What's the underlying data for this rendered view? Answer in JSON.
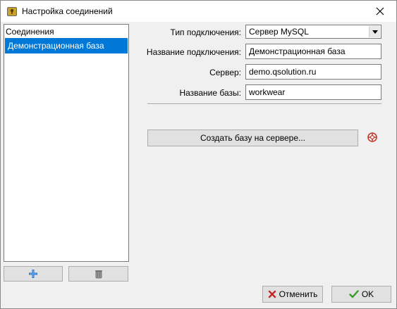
{
  "window": {
    "title": "Настройка соединений"
  },
  "connections": {
    "header": "Соединения",
    "items": [
      "Демонстрационная база"
    ],
    "selected_index": 0
  },
  "form": {
    "connection_type": {
      "label": "Тип подключения:",
      "value": "Сервер MySQL"
    },
    "connection_name": {
      "label": "Название подключения:",
      "value": "Демонстрационная база"
    },
    "server": {
      "label": "Сервер:",
      "value": "demo.qsolution.ru"
    },
    "database_name": {
      "label": "Название базы:",
      "value": "workwear"
    },
    "create_db_button": "Создать базу на сервере..."
  },
  "buttons": {
    "cancel": "Отменить",
    "ok": "OK"
  },
  "icons": {
    "app": "key-lock-icon",
    "add": "plus-icon",
    "delete": "trash-icon",
    "help": "lifebuoy-icon",
    "cancel": "red-x-icon",
    "ok": "green-check-icon"
  },
  "colors": {
    "selection": "#0078d7",
    "window_bg": "#f0f0f0"
  }
}
